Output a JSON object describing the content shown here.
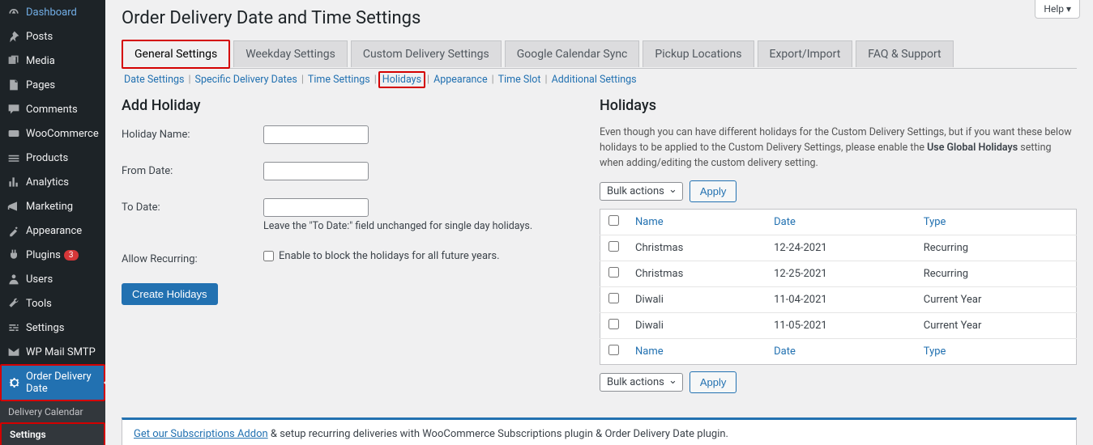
{
  "help_btn": "Help ▾",
  "page_title": "Order Delivery Date and Time Settings",
  "sidebar": [
    {
      "label": "Dashboard",
      "icon": "dashboard"
    },
    {
      "label": "Posts",
      "icon": "pin"
    },
    {
      "label": "Media",
      "icon": "media"
    },
    {
      "label": "Pages",
      "icon": "page"
    },
    {
      "label": "Comments",
      "icon": "comment"
    },
    {
      "label": "WooCommerce",
      "icon": "woo"
    },
    {
      "label": "Products",
      "icon": "products"
    },
    {
      "label": "Analytics",
      "icon": "analytics"
    },
    {
      "label": "Marketing",
      "icon": "marketing"
    },
    {
      "label": "Appearance",
      "icon": "appearance"
    },
    {
      "label": "Plugins",
      "icon": "plugins",
      "badge": "3"
    },
    {
      "label": "Users",
      "icon": "users"
    },
    {
      "label": "Tools",
      "icon": "tools"
    },
    {
      "label": "Settings",
      "icon": "settings"
    },
    {
      "label": "WP Mail SMTP",
      "icon": "mail"
    },
    {
      "label": "Order Delivery Date",
      "icon": "gear",
      "active": true,
      "red": true
    }
  ],
  "sidebar_sub": [
    {
      "label": "Delivery Calendar"
    },
    {
      "label": "Settings",
      "active": true,
      "red": true
    }
  ],
  "tabs": [
    {
      "label": "General Settings",
      "active": true,
      "red": true
    },
    {
      "label": "Weekday Settings"
    },
    {
      "label": "Custom Delivery Settings"
    },
    {
      "label": "Google Calendar Sync"
    },
    {
      "label": "Pickup Locations"
    },
    {
      "label": "Export/Import"
    },
    {
      "label": "FAQ & Support"
    }
  ],
  "subtabs": [
    {
      "label": "Date Settings"
    },
    {
      "label": "Specific Delivery Dates"
    },
    {
      "label": "Time Settings"
    },
    {
      "label": "Holidays",
      "active": true,
      "red": true
    },
    {
      "label": "Appearance"
    },
    {
      "label": "Time Slot"
    },
    {
      "label": "Additional Settings"
    }
  ],
  "left": {
    "title": "Add Holiday",
    "name_label": "Holiday Name:",
    "from_label": "From Date:",
    "to_label": "To Date:",
    "to_help": "Leave the \"To Date:\" field unchanged for single day holidays.",
    "recur_label": "Allow Recurring:",
    "recur_check": "Enable to block the holidays for all future years.",
    "submit": "Create Holidays"
  },
  "right": {
    "title": "Holidays",
    "desc_a": "Even though you can have different holidays for the Custom Delivery Settings, but if you want these below holidays to be applied to the Custom Delivery Settings, please enable the ",
    "desc_b": "Use Global Holidays",
    "desc_c": " setting when adding/editing the custom delivery setting.",
    "bulk": "Bulk actions",
    "apply": "Apply",
    "cols": {
      "name": "Name",
      "date": "Date",
      "type": "Type"
    },
    "rows": [
      {
        "name": "Christmas",
        "date": "12-24-2021",
        "type": "Recurring"
      },
      {
        "name": "Christmas",
        "date": "12-25-2021",
        "type": "Recurring"
      },
      {
        "name": "Diwali",
        "date": "11-04-2021",
        "type": "Current Year"
      },
      {
        "name": "Diwali",
        "date": "11-05-2021",
        "type": "Current Year"
      }
    ]
  },
  "notice": {
    "link": "Get our Subscriptions Addon",
    "rest": " & setup recurring deliveries with WooCommerce Subscriptions plugin & Order Delivery Date plugin."
  }
}
